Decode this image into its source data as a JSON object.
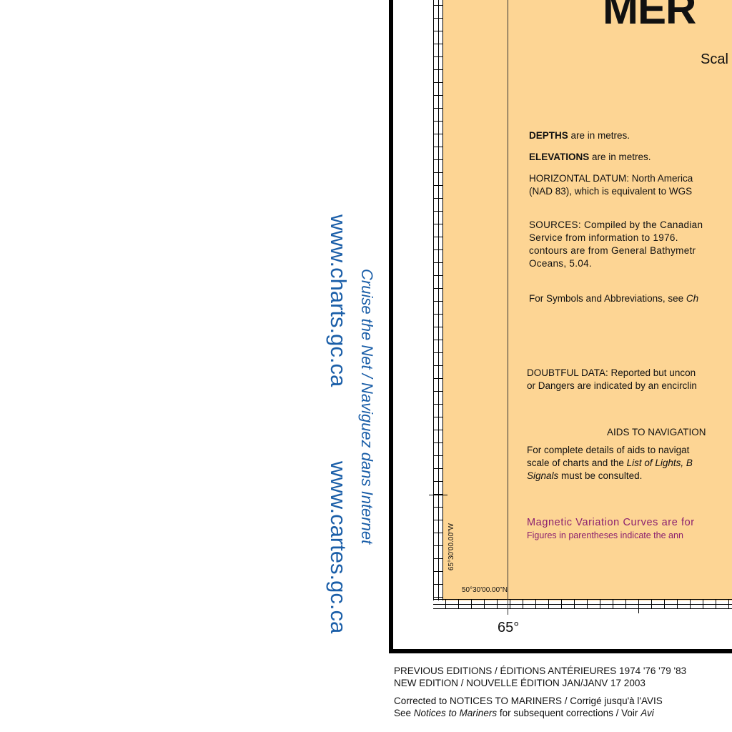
{
  "margin": {
    "url_charts": "www.charts.gc.ca",
    "url_cartes": "www.cartes.gc.ca",
    "cruise_note": "Cruise the Net / Naviguez dans Internet"
  },
  "chart": {
    "title": "MER",
    "scale": "Scal",
    "notes": {
      "depths_bold": "DEPTHS",
      "depths_rest": " are in metres.",
      "elevations_bold": "ELEVATIONS",
      "elevations_rest": " are in metres.",
      "horizontal_1": "HORIZONTAL DATUM: North America",
      "horizontal_2": "(NAD 83), which is equivalent to WGS",
      "sources_1": "SOURCES: Compiled by the Canadian",
      "sources_2": "Service from information to 1976.",
      "sources_3": "contours are from General Bathymetr",
      "sources_4": "Oceans, 5.04.",
      "symbols_1": "For Symbols and Abbreviations, see ",
      "symbols_2": "Ch",
      "doubtful_1": "DOUBTFUL DATA: Reported but uncon",
      "doubtful_2": "or Dangers are indicated by an encirclin",
      "aids_heading": "AIDS TO NAVIGATION",
      "aids_1": "For complete details of aids to navigat",
      "aids_2a": "scale of charts and the ",
      "aids_2b": "List of Lights, B",
      "aids_3a": "Signals",
      "aids_3b": " must be consulted.",
      "magnetic_1": "Magnetic Variation Curves are for",
      "magnetic_2": "Figures in parentheses indicate the ann"
    },
    "graticule": {
      "lon_label": "65°30'00.00\"W",
      "lat_label": "50°30'00.00\"N",
      "deg_label": "65°"
    }
  },
  "footer": {
    "previous_editions": "PREVIOUS EDITIONS / ÉDITIONS ANTÉRIEURES  1974 '76 '79 '83",
    "new_edition": "NEW EDITION / NOUVELLE ÉDITION   JAN/JANV 17 2003",
    "corrected": "Corrected to NOTICES TO MARINERS / Corrigé jusqu'à l'AVIS",
    "see_1": "See ",
    "see_2": "Notices to Mariners",
    "see_3": " for subsequent corrections / Voir ",
    "see_4": "Avi"
  }
}
